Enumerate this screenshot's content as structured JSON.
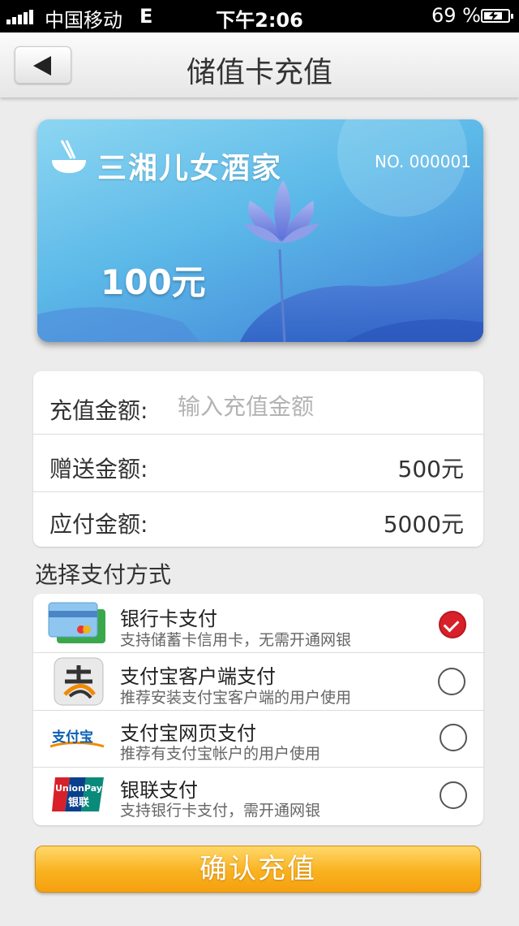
{
  "status_bar": {
    "carrier": "中国移动",
    "network": "E",
    "time": "下午2:06",
    "battery": "69 %"
  },
  "nav": {
    "title": "储值卡充值",
    "back_icon": "back-arrow-icon"
  },
  "card": {
    "name": "三湘儿女酒家",
    "number": "NO. 000001",
    "amount": "100元",
    "logo_icon": "bowl-chopsticks-icon",
    "colors": {
      "top": "#8dd6f2",
      "bottom": "#3f7fd6"
    }
  },
  "form": {
    "recharge_label": "充值金额:",
    "recharge_placeholder": "输入充值金额",
    "bonus_label": "赠送金额:",
    "bonus_value": "500元",
    "payable_label": "应付金额:",
    "payable_value": "5000元"
  },
  "payment": {
    "section_title": "选择支付方式",
    "methods": [
      {
        "title": "银行卡支付",
        "subtitle": "支持储蓄卡信用卡，无需开通网银",
        "icon": "bank-card-icon",
        "selected": true
      },
      {
        "title": "支付宝客户端支付",
        "subtitle": "推荐安装支付宝客户端的用户使用",
        "icon": "alipay-app-icon",
        "selected": false
      },
      {
        "title": "支付宝网页支付",
        "subtitle": "推荐有支付宝帐户的用户使用",
        "icon": "alipay-web-logo",
        "selected": false
      },
      {
        "title": "银联支付",
        "subtitle": "支持银行卡支付，需开通网银",
        "icon": "unionpay-icon",
        "selected": false
      }
    ]
  },
  "confirm_button": "确认充值",
  "colors": {
    "accent": "#f9b21f",
    "selected": "#d8202a"
  }
}
